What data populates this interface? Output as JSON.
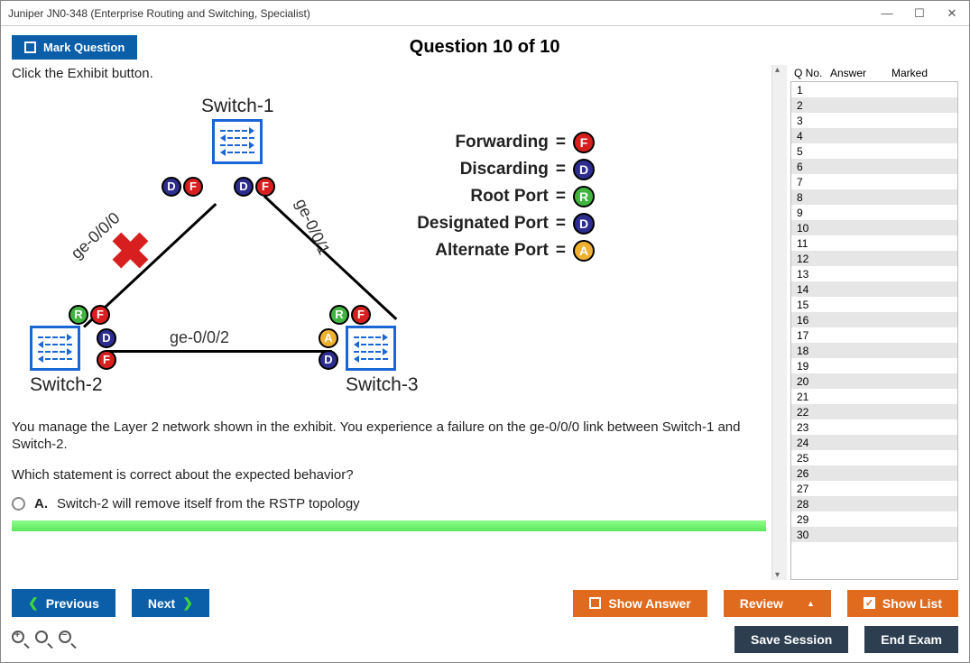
{
  "window": {
    "title": "Juniper JN0-348 (Enterprise Routing and Switching, Specialist)"
  },
  "header": {
    "mark_label": "Mark Question",
    "counter": "Question 10 of 10"
  },
  "question": {
    "intro": "Click the Exhibit button.",
    "body1": "You manage the Layer 2 network shown in the exhibit. You experience a failure on the ge-0/0/0 link between Switch-1 and Switch-2.",
    "body2": "Which statement is correct about the expected behavior?"
  },
  "exhibit": {
    "switch1": "Switch-1",
    "switch2": "Switch-2",
    "switch3": "Switch-3",
    "link00": "ge-0/0/0",
    "link01": "ge-0/0/1",
    "link02": "ge-0/0/2",
    "legend": {
      "forwarding": "Forwarding",
      "discarding": "Discarding",
      "root_port": "Root Port",
      "designated": "Designated Port",
      "alternate": "Alternate Port"
    }
  },
  "options": {
    "A": {
      "letter": "A.",
      "text": "Switch-2 will remove itself from the RSTP topology"
    }
  },
  "sidebar": {
    "cols": {
      "qno": "Q No.",
      "answer": "Answer",
      "marked": "Marked"
    },
    "rows": [
      1,
      2,
      3,
      4,
      5,
      6,
      7,
      8,
      9,
      10,
      11,
      12,
      13,
      14,
      15,
      16,
      17,
      18,
      19,
      20,
      21,
      22,
      23,
      24,
      25,
      26,
      27,
      28,
      29,
      30
    ]
  },
  "footer": {
    "previous": "Previous",
    "next": "Next",
    "show_answer": "Show Answer",
    "review": "Review",
    "show_list": "Show List",
    "save_session": "Save Session",
    "end_exam": "End Exam"
  }
}
